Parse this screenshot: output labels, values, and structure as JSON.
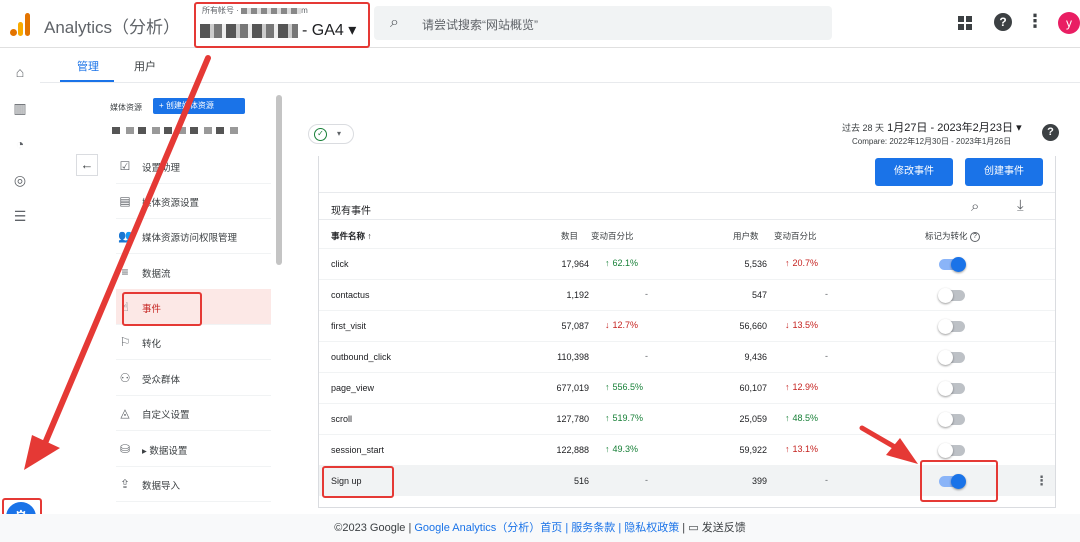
{
  "header": {
    "app_title": "Analytics（分析）",
    "account_label": "所有帐号",
    "account_suffix": "m",
    "property_suffix": "- GA4 ▾",
    "search_placeholder": "请尝试搜索“网站概览”",
    "avatar_letter": "y"
  },
  "tabs": [
    {
      "label": "管理",
      "active": true
    },
    {
      "label": "用户",
      "active": false
    }
  ],
  "panel": {
    "label": "媒体资源",
    "create_button": "+ 创建媒体资源",
    "items": [
      {
        "label": "设置助理",
        "icon": "checklist-icon"
      },
      {
        "label": "媒体资源设置",
        "icon": "property-settings-icon"
      },
      {
        "label": "媒体资源访问权限管理",
        "icon": "people-icon"
      },
      {
        "label": "数据流",
        "icon": "data-stream-icon"
      },
      {
        "label": "事件",
        "icon": "touch-icon",
        "active": true
      },
      {
        "label": "转化",
        "icon": "flag-icon"
      },
      {
        "label": "受众群体",
        "icon": "audience-icon"
      },
      {
        "label": "自定义设置",
        "icon": "shapes-icon"
      },
      {
        "label": "▸ 数据设置",
        "icon": "database-icon"
      },
      {
        "label": "数据导入",
        "icon": "upload-icon"
      }
    ]
  },
  "date": {
    "label": "过去 28 天",
    "range": "1月27日 - 2023年2月23日 ▾",
    "compare": "Compare: 2022年12月30日 - 2023年1月26日"
  },
  "buttons": {
    "modify": "修改事件",
    "create": "创建事件"
  },
  "card": {
    "title": "现有事件"
  },
  "columns": {
    "name": "事件名称 ↑",
    "count": "数目",
    "count_change": "变动百分比",
    "users": "用户数",
    "users_change": "变动百分比",
    "conversion": "标记为转化"
  },
  "events": [
    {
      "name": "click",
      "count": "17,964",
      "count_change": "62.1%",
      "count_dir": "up",
      "users": "5,536",
      "users_change": "20.7%",
      "users_dir": "down_up_red",
      "conversion": true
    },
    {
      "name": "contactus",
      "count": "1,192",
      "count_change": "-",
      "count_dir": "none",
      "users": "547",
      "users_change": "-",
      "users_dir": "none",
      "conversion": false
    },
    {
      "name": "first_visit",
      "count": "57,087",
      "count_change": "12.7%",
      "count_dir": "down",
      "users": "56,660",
      "users_change": "13.5%",
      "users_dir": "down",
      "conversion": false
    },
    {
      "name": "outbound_click",
      "count": "110,398",
      "count_change": "-",
      "count_dir": "none",
      "users": "9,436",
      "users_change": "-",
      "users_dir": "none",
      "conversion": false
    },
    {
      "name": "page_view",
      "count": "677,019",
      "count_change": "556.5%",
      "count_dir": "up",
      "users": "60,107",
      "users_change": "12.9%",
      "users_dir": "down_up_red",
      "conversion": false
    },
    {
      "name": "scroll",
      "count": "127,780",
      "count_change": "519.7%",
      "count_dir": "up",
      "users": "25,059",
      "users_change": "48.5%",
      "users_dir": "up",
      "conversion": false
    },
    {
      "name": "session_start",
      "count": "122,888",
      "count_change": "49.3%",
      "count_dir": "up",
      "users": "59,922",
      "users_change": "13.1%",
      "users_dir": "down_up_red",
      "conversion": false
    },
    {
      "name": "Sign up",
      "count": "516",
      "count_change": "-",
      "count_dir": "none",
      "users": "399",
      "users_change": "-",
      "users_dir": "none",
      "conversion": true
    }
  ],
  "footer": {
    "copyright": "©2023 Google",
    "links": "Google Analytics（分析）首页 | 服务条款 | 隐私权政策",
    "feedback": "发送反馈"
  },
  "colors": {
    "accent": "#1a73e8",
    "annotation_red": "#e53935",
    "up_green": "#188038",
    "down_red": "#c5221f"
  }
}
